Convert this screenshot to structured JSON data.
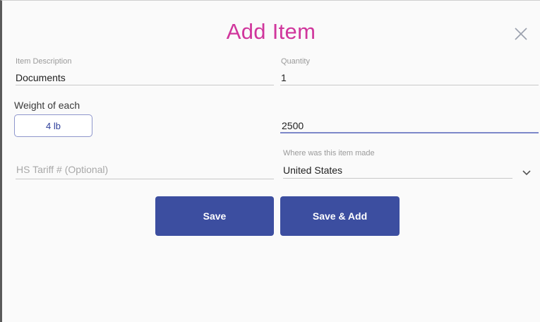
{
  "dialog": {
    "title": "Add Item",
    "close_icon": "close-icon"
  },
  "form": {
    "item_description": {
      "label": "Item Description",
      "value": "Documents"
    },
    "quantity": {
      "label": "Quantity",
      "value": "1"
    },
    "weight": {
      "label": "Weight of each",
      "button_label": "4 lb"
    },
    "value_field": {
      "value": "2500"
    },
    "hs_tariff": {
      "placeholder": "HS Tariff # (Optional)"
    },
    "origin": {
      "label": "Where was this item made",
      "value": "United States",
      "icon": "chevron-down-icon"
    }
  },
  "actions": {
    "save_label": "Save",
    "save_add_label": "Save & Add"
  },
  "colors": {
    "title": "#d0369c",
    "primary_button": "#3c4ea0",
    "active_underline": "#7d88c9"
  }
}
